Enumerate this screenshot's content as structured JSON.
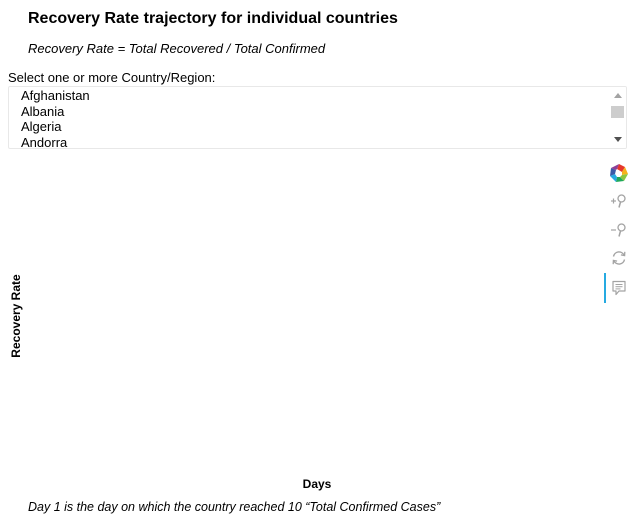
{
  "header": {
    "title": "Recovery Rate trajectory for individual countries",
    "subtitle": "Recovery Rate = Total Recovered / Total Confirmed"
  },
  "selector": {
    "label": "Select one or more Country/Region:",
    "options": [
      "Afghanistan",
      "Albania",
      "Algeria",
      "Andorra"
    ]
  },
  "plot": {
    "ylabel": "Recovery Rate",
    "xlabel": "Days",
    "footnote": "Day 1 is the day on which the country reached 10 “Total Confirmed Cases”"
  },
  "toolbar": {
    "tools": [
      "bokeh-logo-icon",
      "zoom-in-icon",
      "zoom-out-icon",
      "reset-icon",
      "hover-icon"
    ],
    "active_tool": "hover-icon",
    "colors": {
      "icon": "#a3a3a3",
      "active_indicator": "#26aae1"
    }
  }
}
